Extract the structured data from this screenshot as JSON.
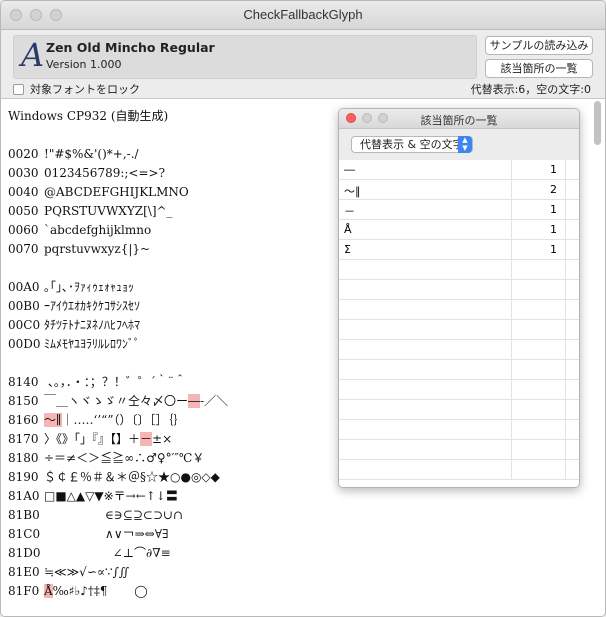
{
  "window": {
    "title": "CheckFallbackGlyph"
  },
  "font_info": {
    "icon_letter": "A",
    "name": "Zen Old Mincho Regular",
    "version": "Version 1.000"
  },
  "buttons": {
    "load_sample": "サンプルの読み込み",
    "matches_list": "該当箇所の一覧"
  },
  "lock_checkbox": {
    "label": "対象フォントをロック",
    "checked": false
  },
  "stats": "代替表示:6，空の文字:0",
  "content": {
    "heading": "Windows CP932 (自動生成)",
    "rows": [
      {
        "code": "0020",
        "text": "!\"#$%&'()*+,-./"
      },
      {
        "code": "0030",
        "text": "0123456789:;<=>?"
      },
      {
        "code": "0040",
        "text": "@ABCDEFGHIJKLMNO"
      },
      {
        "code": "0050",
        "text": "PQRSTUVWXYZ[\\]^_"
      },
      {
        "code": "0060",
        "text": "`abcdefghijklmno"
      },
      {
        "code": "0070",
        "text": "pqrstuvwxyz{|}~"
      },
      {
        "gap": true
      },
      {
        "code": "00A0",
        "text": "｡｢｣､･ｦｧｨｩｪｫｬｭｮｯ"
      },
      {
        "code": "00B0",
        "text": "ｰｱｲｳｴｵｶｷｸｹｺｻｼｽｾｿ"
      },
      {
        "code": "00C0",
        "text": "ﾀﾁﾂﾃﾄﾅﾆﾇﾈﾉﾊﾋﾌﾍﾎﾏ"
      },
      {
        "code": "00D0",
        "text": "ﾐﾑﾒﾓﾔﾕﾖﾗﾘﾙﾚﾛﾜﾝﾞﾟ"
      },
      {
        "gap": true
      },
      {
        "code": "8140",
        "text": " 、。，．・：；？！゛゜´｀¨＾"
      },
      {
        "code": "8150",
        "text": "￣＿ヽヾゝゞ〃仝々〆〇ー",
        "hl": "―",
        "after": "‐／＼"
      },
      {
        "code": "8160",
        "text": "",
        "hl": "～∥",
        "after": "｜…‥‘’“”（）〔〕［］｛｝"
      },
      {
        "code": "8170",
        "text": "〉《》「」『』【】＋",
        "hl": "－",
        "after": "±×"
      },
      {
        "code": "8180",
        "text": "÷＝≠＜＞≦≧∞∴♂♀°′″℃￥"
      },
      {
        "code": "8190",
        "text": "＄￠￡％＃＆＊＠§☆★○●◎◇◆"
      },
      {
        "code": "81A0",
        "text": "□■△▲▽▼※〒→←↑↓〓"
      },
      {
        "code": "81B0",
        "text": "                ∈∋⊆⊇⊂⊃∪∩"
      },
      {
        "code": "81C0",
        "text": "                ∧∨￢⇒⇔∀∃"
      },
      {
        "code": "81D0",
        "text": "                  ∠⊥⌒∂∇≡"
      },
      {
        "code": "81E0",
        "text": "≒≪≫√∽∝∵∫∬"
      },
      {
        "code": "81F0",
        "text": "",
        "hl": "Å",
        "after": "‰♯♭♪†‡¶       ◯"
      }
    ]
  },
  "matches_panel": {
    "title": "該当箇所の一覧",
    "filter_value": "代替表示 & 空の文字",
    "rows": [
      {
        "char": "―",
        "count": "1"
      },
      {
        "char": "～∥",
        "count": "2"
      },
      {
        "char": "－",
        "count": "1"
      },
      {
        "char": "Å",
        "count": "1"
      },
      {
        "char": "Σ",
        "count": "1"
      }
    ],
    "empty_rows": 11
  }
}
